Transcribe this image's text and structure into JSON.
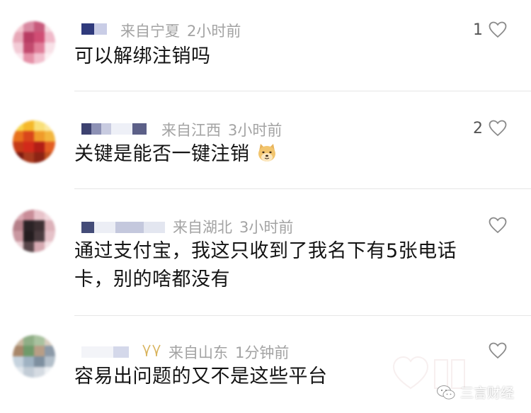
{
  "comments": [
    {
      "location": "来自宁夏",
      "time": "2小时前",
      "text": "可以解绑注销吗",
      "likes": "1"
    },
    {
      "location": "来自江西",
      "time": "3小时前",
      "text": "关键是能否一键注销",
      "likes": "2",
      "emoji": "doge-emoji"
    },
    {
      "location": "来自湖北",
      "time": "3小时前",
      "text": "通过支付宝，我这只收到了我名下有5张电话卡，别的啥都没有",
      "likes": ""
    },
    {
      "location": "来自山东",
      "time": "1分钟前",
      "text": "容易出问题的又不是这些平台",
      "likes": ""
    }
  ],
  "watermark": {
    "text": "三言财经",
    "icon": "wechat-icon"
  },
  "colors": {
    "meta": "#a3a3a3",
    "text": "#141414",
    "divider": "#e6e6e6",
    "heart": "#8a8a8a"
  }
}
